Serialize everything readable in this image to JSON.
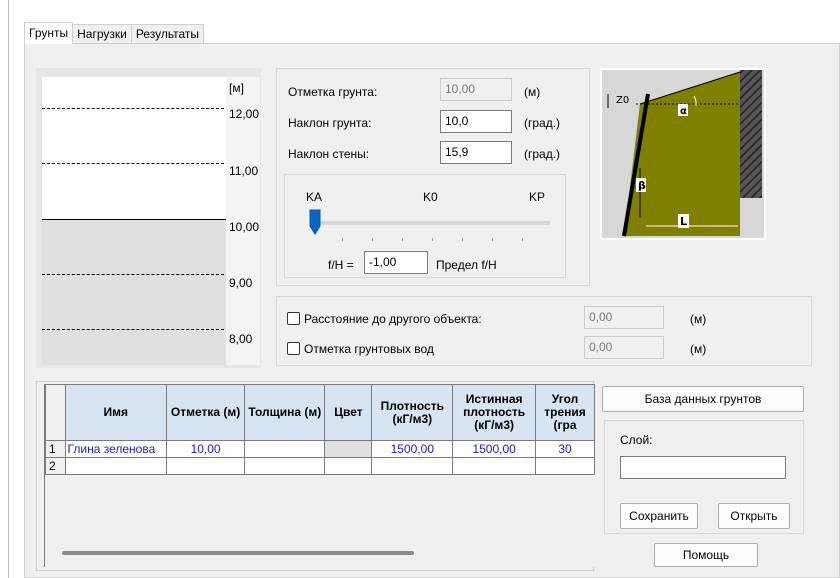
{
  "tabs": [
    "Грунты",
    "Нагрузки",
    "Результаты"
  ],
  "chart": {
    "unit_label": "[м]",
    "elevations": [
      "12,00",
      "11,00",
      "10,00",
      "9,00",
      "8,00"
    ],
    "ground_level": "10,00"
  },
  "params": {
    "elevation_label": "Отметка грунта:",
    "elevation_value": "10,00",
    "elevation_unit": "(м)",
    "slope_label": "Наклон грунта:",
    "slope_value": "10,0",
    "slope_unit": "(град.)",
    "wall_label": "Наклон стены:",
    "wall_value": "15,9",
    "wall_unit": "(град.)"
  },
  "slider": {
    "label_ka": "KA",
    "label_k0": "K0",
    "label_kp": "KP",
    "position": 0.0,
    "fh_label": "f/H =",
    "fh_value": "-1,00",
    "limit_label": "Предел f/H"
  },
  "illustration": {
    "z0_label": "Z0",
    "alpha_label": "α",
    "beta_label": "β",
    "l_label": "L",
    "soil_color": "#808000"
  },
  "checks": {
    "distance_label": "Расстояние до другого объекта:",
    "distance_value": "0,00",
    "distance_unit": "(м)",
    "distance_checked": false,
    "groundwater_label": "Отметка грунтовых вод",
    "groundwater_value": "0,00",
    "groundwater_unit": "(м)",
    "groundwater_checked": false
  },
  "table": {
    "headers": [
      "Имя",
      "Отметка (м)",
      "Толщина (м)",
      "Цвет",
      "Плотность (кГ/м3)",
      "Истинная плотность (кГ/м3)",
      "Угол трения (гра"
    ],
    "rows": [
      {
        "num": "1",
        "name": "Глина зеленова",
        "elevation": "10,00",
        "thickness": "",
        "color": "",
        "density": "1500,00",
        "true_density": "1500,00",
        "friction": "30"
      },
      {
        "num": "2",
        "name": "",
        "elevation": "",
        "thickness": "",
        "color": "",
        "density": "",
        "true_density": "",
        "friction": ""
      }
    ]
  },
  "buttons": {
    "soil_db": "База данных грунтов",
    "layer_label": "Слой:",
    "layer_value": "",
    "save": "Сохранить",
    "open": "Открыть",
    "help": "Помощь"
  }
}
